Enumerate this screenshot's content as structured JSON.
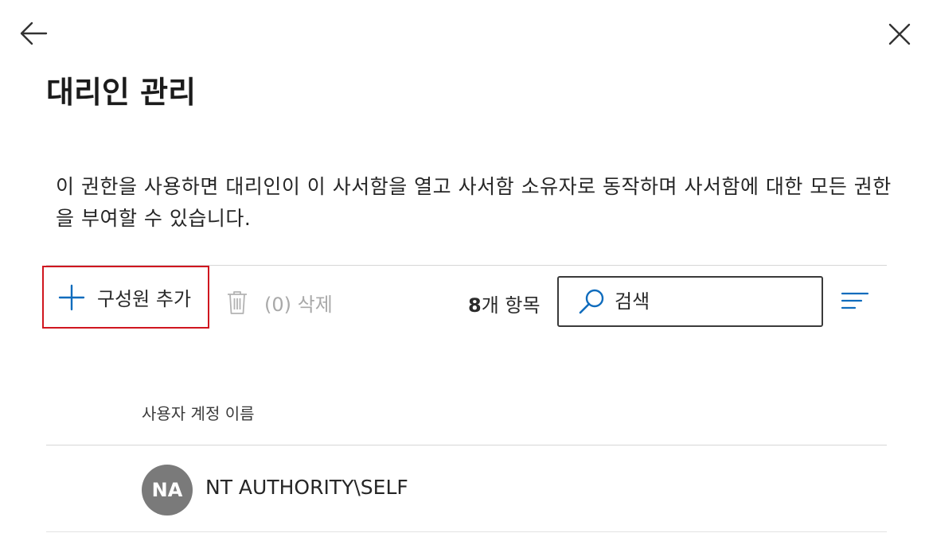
{
  "panel": {
    "title": "대리인 관리",
    "description": "이 권한을 사용하면 대리인이 이 사서함을 열고 사서함 소유자로 동작하며 사서함에 대한 모든 권한을 부여할 수 있습니다.",
    "back_icon": "arrow-left-icon",
    "close_icon": "close-icon"
  },
  "toolbar": {
    "add_label": "구성원 추가",
    "add_icon": "plus-icon",
    "delete_label": "(0) 삭제",
    "delete_icon": "trash-icon",
    "item_count_number": "8",
    "item_count_suffix": "개 항목",
    "search_placeholder": "검색",
    "search_icon": "search-icon",
    "sort_icon": "sort-icon"
  },
  "table": {
    "column_header": "사용자 계정 이름",
    "rows": [
      {
        "initials": "NA",
        "name": "NT AUTHORITY\\SELF"
      }
    ]
  },
  "colors": {
    "accent": "#0f6cbd",
    "highlight_border": "#d0161f",
    "avatar_bg": "#7a7a7a",
    "disabled_text": "#a9a9a9"
  }
}
